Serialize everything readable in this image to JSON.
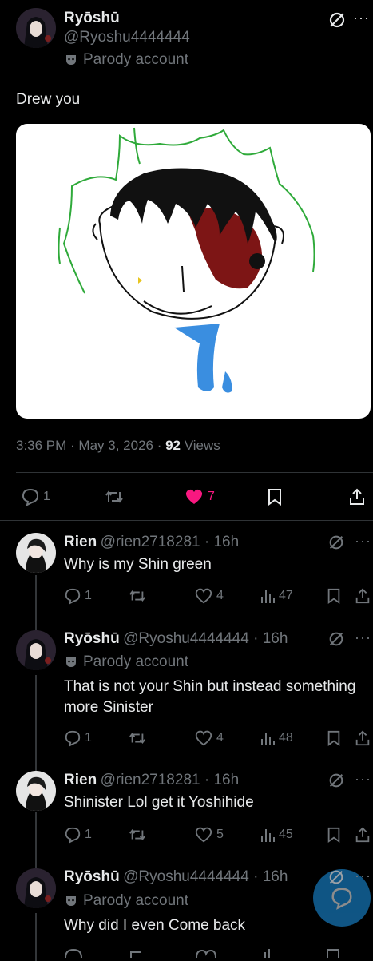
{
  "main_post": {
    "name": "Ryōshū",
    "handle": "@Ryoshu4444444",
    "badge": "Parody account",
    "text": "Drew you",
    "time": "3:36 PM · May 3, 2026 · ",
    "views_count": "92",
    "views_label": " Views",
    "replies": "1",
    "likes": "7"
  },
  "replies": [
    {
      "name": "Rien",
      "handle": "@rien2718281 · 16h",
      "text": "Why is my Shin green",
      "replies": "1",
      "likes": "4",
      "views": "47"
    },
    {
      "name": "Ryōshū",
      "handle": "@Ryoshu4444444 · 16h",
      "badge": "Parody account",
      "text": "That is not your Shin but instead something more Sinister",
      "replies": "1",
      "likes": "4",
      "views": "48"
    },
    {
      "name": "Rien",
      "handle": "@rien2718281 · 16h",
      "text": "Shinister Lol get it Yoshihide",
      "replies": "1",
      "likes": "5",
      "views": "45"
    },
    {
      "name": "Ryōshū",
      "handle": "@Ryoshu4444444 · 16h",
      "badge": "Parody account",
      "text": "Why did I even Come back"
    }
  ],
  "colors": {
    "like": "#f91880",
    "accent": "#1d9bf0",
    "muted": "#71767b"
  },
  "icons": [
    "reply-icon",
    "repost-icon",
    "like-icon",
    "views-icon",
    "bookmark-icon",
    "share-icon",
    "grok-icon",
    "more-icon",
    "parody-mask-icon",
    "compose-icon"
  ]
}
